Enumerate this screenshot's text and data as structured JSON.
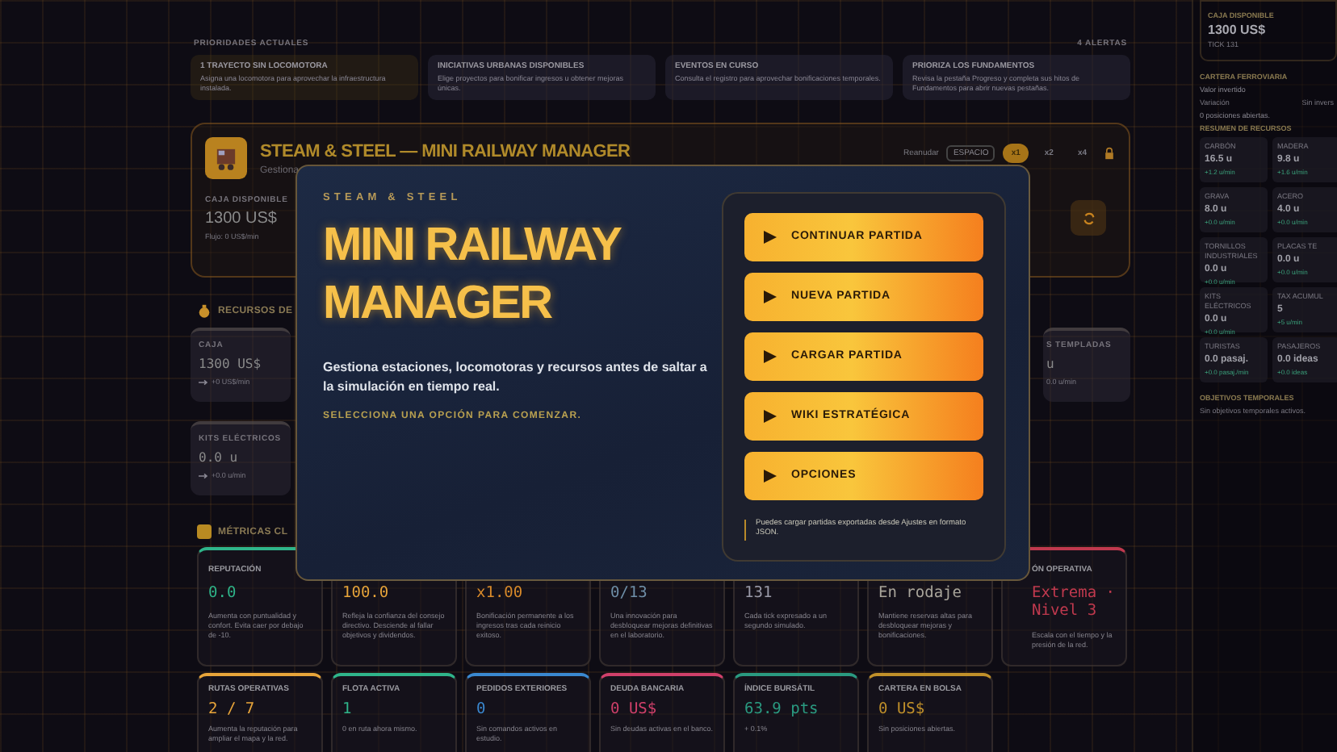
{
  "alerts": {
    "heading": "PRIORIDADES ACTUALES",
    "count": "4 ALERTAS",
    "items": [
      {
        "title": "1 TRAYECTO SIN LOCOMOTORA",
        "text": "Asigna una locomotora para aprovechar la infraestructura instalada."
      },
      {
        "title": "INICIATIVAS URBANAS DISPONIBLES",
        "text": "Elige proyectos para bonificar ingresos u obtener mejoras únicas."
      },
      {
        "title": "EVENTOS EN CURSO",
        "text": "Consulta el registro para aprovechar bonificaciones temporales."
      },
      {
        "title": "PRIORIZA LOS FUNDAMENTOS",
        "text": "Revisa la pestaña Progreso y completa sus hitos de Fundamentos para abrir nuevas pestañas."
      }
    ]
  },
  "header": {
    "title": "STEAM & STEEL — MINI RAILWAY MANAGER",
    "subtitle": "Gestiona",
    "resume": "Reanudar",
    "key": "ESPACIO",
    "speeds": [
      {
        "label": "x1",
        "selected": true
      },
      {
        "label": "x2",
        "selected": false
      },
      {
        "label": "x4",
        "selected": false
      }
    ],
    "cash_label": "CAJA DISPONIBLE",
    "cash": "1300 US$",
    "flow": "Flujo: 0 US$/min"
  },
  "resources": {
    "heading": "RECURSOS DE",
    "left": [
      {
        "label": "CAJA",
        "value": "1300 US$",
        "rate": "+0 US$/min"
      },
      {
        "label": "KITS ELÉCTRICOS",
        "value": "0.0 u",
        "rate": "+0.0 u/min"
      }
    ],
    "right": [
      {
        "label": "S TEMPLADAS",
        "value": "u",
        "rate": "0.0 u/min"
      }
    ]
  },
  "metrics": {
    "heading": "MÉTRICAS CL",
    "rows": [
      [
        {
          "label": "REPUTACIÓN",
          "value": "0.0",
          "text": "Aumenta con puntualidad y confort. Evita caer por debajo de -10.",
          "color": "#2fb58a"
        },
        {
          "value": "100.0",
          "text": "Refleja la confianza del consejo directivo. Desciende al fallar objetivos y dividendos.",
          "color": "#e8a53a"
        },
        {
          "value": "x1.00",
          "text": "Bonificación permanente a los ingresos tras cada reinicio exitoso.",
          "color": "#d98a2a"
        },
        {
          "value": "0/13",
          "text": "Una innovación para desbloquear mejoras definitivas en el laboratorio.",
          "color": "#6f8fa8"
        },
        {
          "value": "131",
          "text": "Cada tick expresado a un segundo simulado.",
          "color": "#9a9aa8"
        },
        {
          "value": "En rodaje",
          "text": "Mantiene reservas altas para desbloquear mejoras y bonificaciones.",
          "color": "#a8a49a"
        },
        {
          "label": "ÓN OPERATIVA",
          "value": "Extrema · Nivel 3",
          "text": "Escala con el tiempo y la presión de la red.",
          "color": "#c0394e"
        }
      ],
      [
        {
          "label": "RUTAS OPERATIVAS",
          "value": "2 / 7",
          "text": "Aumenta la reputación para ampliar el mapa y la red.",
          "color": "#e8a53a"
        },
        {
          "label": "FLOTA ACTIVA",
          "value": "1",
          "text": "0 en ruta ahora mismo.",
          "color": "#2fb58a"
        },
        {
          "label": "PEDIDOS EXTERIORES",
          "value": "0",
          "text": "Sin comandos activos en estudio.",
          "color": "#3a88d0"
        },
        {
          "label": "DEUDA BANCARIA",
          "value": "0 US$",
          "text": "Sin deudas activas en el banco.",
          "color": "#d0406a"
        },
        {
          "label": "ÍNDICE BURSÁTIL",
          "value": "63.9 pts",
          "text": "+ 0.1%",
          "color": "#2a9a80"
        },
        {
          "label": "CARTERA EN BOLSA",
          "value": "0 US$",
          "text": "Sin posiciones abiertas.",
          "color": "#c0902a"
        }
      ]
    ]
  },
  "sidebar": {
    "cash_label": "CAJA DISPONIBLE",
    "cash": "1300 US$",
    "tick": "TICK 131",
    "portfolio_heading": "CARTERA FERROVIARIA",
    "invested": "Valor invertido",
    "change": "Variación",
    "change_value": "Sin invers",
    "positions": "0 posiciones abiertas.",
    "summary_heading": "RESUMEN DE RECURSOS",
    "resources": [
      {
        "label": "CARBÓN",
        "value": "16.5 u",
        "rate": "+1.2 u/min"
      },
      {
        "label": "MADERA",
        "value": "9.8 u",
        "rate": "+1.6 u/min"
      },
      {
        "label": "GRAVA",
        "value": "8.0 u",
        "rate": "+0.0 u/min"
      },
      {
        "label": "ACERO",
        "value": "4.0 u",
        "rate": "+0.0 u/min"
      },
      {
        "label": "TORNILLOS INDUSTRIALES",
        "value": "0.0 u",
        "rate": "+0.0 u/min"
      },
      {
        "label": "PLACAS TE",
        "value": "0.0 u",
        "rate": "+0.0 u/min"
      },
      {
        "label": "KITS ELÉCTRICOS",
        "value": "0.0 u",
        "rate": "+0.0 u/min"
      },
      {
        "label": "TAX ACUMUL",
        "value": "5",
        "rate": "+5 u/min"
      },
      {
        "label": "TURISTAS",
        "value": "0.0 pasaj.",
        "rate": "+0.0 pasaj./min"
      },
      {
        "label": "PASAJEROS",
        "value": "0.0 ideas",
        "rate": "+0.0 ideas"
      }
    ],
    "objectives_heading": "OBJETIVOS TEMPORALES",
    "objectives": "Sin objetivos temporales activos."
  },
  "modal": {
    "eyebrow": "STEAM & STEEL",
    "title_lines": [
      "MINI RAILWAY",
      "MANAGER"
    ],
    "description": "Gestiona estaciones, locomotoras y recursos antes de saltar a la simulación en tiempo real.",
    "prompt": "SELECCIONA UNA OPCIÓN PARA COMENZAR.",
    "buttons": [
      "CONTINUAR PARTIDA",
      "NUEVA PARTIDA",
      "CARGAR PARTIDA",
      "WIKI ESTRATÉGICA",
      "OPCIONES"
    ],
    "note": "Puedes cargar partidas exportadas desde Ajustes en formato JSON."
  }
}
